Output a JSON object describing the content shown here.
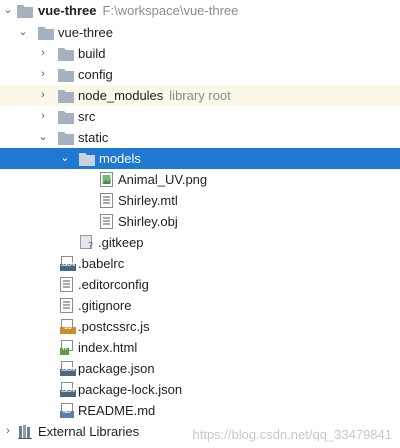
{
  "project": {
    "name": "vue-three",
    "path": "F:\\workspace\\vue-three"
  },
  "tree": {
    "vue_three_folder": "vue-three",
    "build": "build",
    "config": "config",
    "node_modules": "node_modules",
    "node_modules_hint": "library root",
    "src": "src",
    "static": "static",
    "models": "models",
    "animal_uv": "Animal_UV.png",
    "shirley_mtl": "Shirley.mtl",
    "shirley_obj": "Shirley.obj",
    "gitkeep": ".gitkeep",
    "babelrc": ".babelrc",
    "editorconfig": ".editorconfig",
    "gitignore": ".gitignore",
    "postcssrc": ".postcssrc.js",
    "index_html": "index.html",
    "package_json": "package.json",
    "package_lock": "package-lock.json",
    "readme": "README.md",
    "external_libraries": "External Libraries"
  },
  "badges": {
    "json": "JSON",
    "js": "JS",
    "h": "H",
    "md": "MD"
  },
  "watermark": "https://blog.csdn.net/qq_33479841",
  "colors": {
    "selection": "#1f78d1",
    "folder": "#a5b1bf",
    "highlight_row": "#fcf8e8"
  }
}
